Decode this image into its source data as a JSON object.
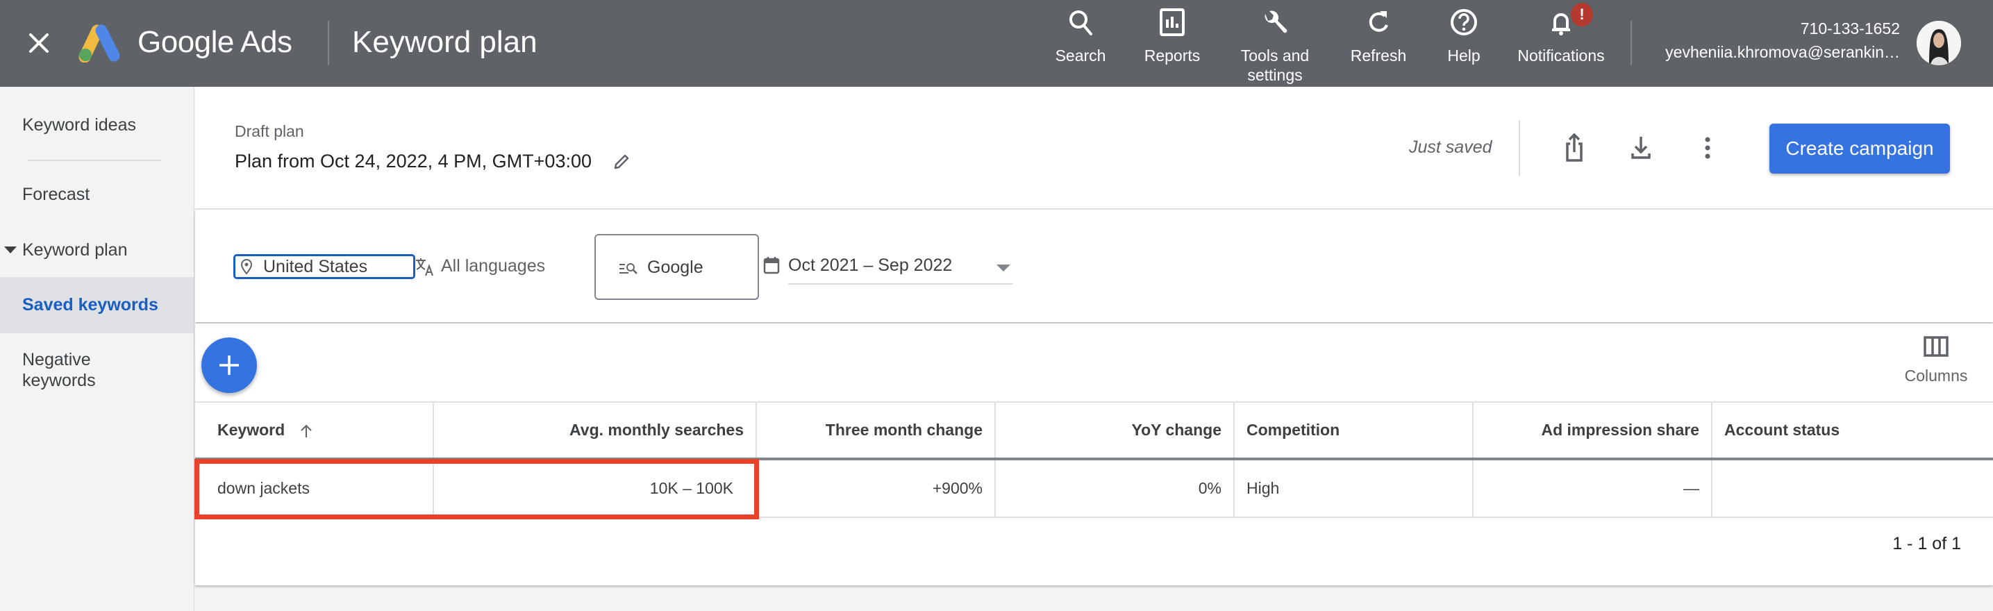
{
  "topbar": {
    "brand": "Google Ads",
    "page_title": "Keyword plan",
    "nav": [
      {
        "id": "search",
        "label": "Search",
        "icon": "search-icon"
      },
      {
        "id": "reports",
        "label": "Reports",
        "icon": "reports-icon"
      },
      {
        "id": "tools",
        "label": "Tools and settings",
        "icon": "wrench-icon"
      },
      {
        "id": "refresh",
        "label": "Refresh",
        "icon": "refresh-icon"
      },
      {
        "id": "help",
        "label": "Help",
        "icon": "help-icon"
      },
      {
        "id": "notifications",
        "label": "Notifications",
        "icon": "bell-icon",
        "badge": "!"
      }
    ],
    "account": {
      "customer_id": "710-133-1652",
      "email": "yevheniia.khromova@serankin…"
    }
  },
  "sidebar": {
    "items": [
      {
        "label": "Keyword ideas",
        "active": false
      },
      {
        "label": "Forecast",
        "active": false
      },
      {
        "label": "Keyword plan",
        "active": false,
        "expanded": true
      },
      {
        "label": "Saved keywords",
        "active": true
      },
      {
        "label": "Negative keywords",
        "active": false
      }
    ]
  },
  "plan": {
    "draft_label": "Draft plan",
    "name": "Plan from Oct 24, 2022, 4 PM, GMT+03:00",
    "save_status": "Just saved",
    "create_campaign_label": "Create campaign"
  },
  "filters": {
    "location": "United States",
    "language": "All languages",
    "network": "Google",
    "date_range": "Oct 2021 – Sep 2022"
  },
  "table": {
    "columns_label": "Columns",
    "headers": [
      "Keyword",
      "Avg. monthly searches",
      "Three month change",
      "YoY change",
      "Competition",
      "Ad impression share",
      "Account status"
    ],
    "sorted_column": "Keyword",
    "sort_direction": "ascending",
    "rows": [
      {
        "keyword": "down jackets",
        "avg_monthly_searches": "10K – 100K",
        "three_month_change": "+900%",
        "yoy_change": "0%",
        "competition": "High",
        "ad_impression_share": "—",
        "account_status": ""
      }
    ],
    "pagination": "1 - 1 of 1"
  },
  "colors": {
    "topbar_bg": "#5f6368",
    "accent_blue": "#3574e0",
    "active_nav_text": "#1a5ec2",
    "highlight_red": "#e8412c",
    "notification_badge": "#b5392e"
  }
}
